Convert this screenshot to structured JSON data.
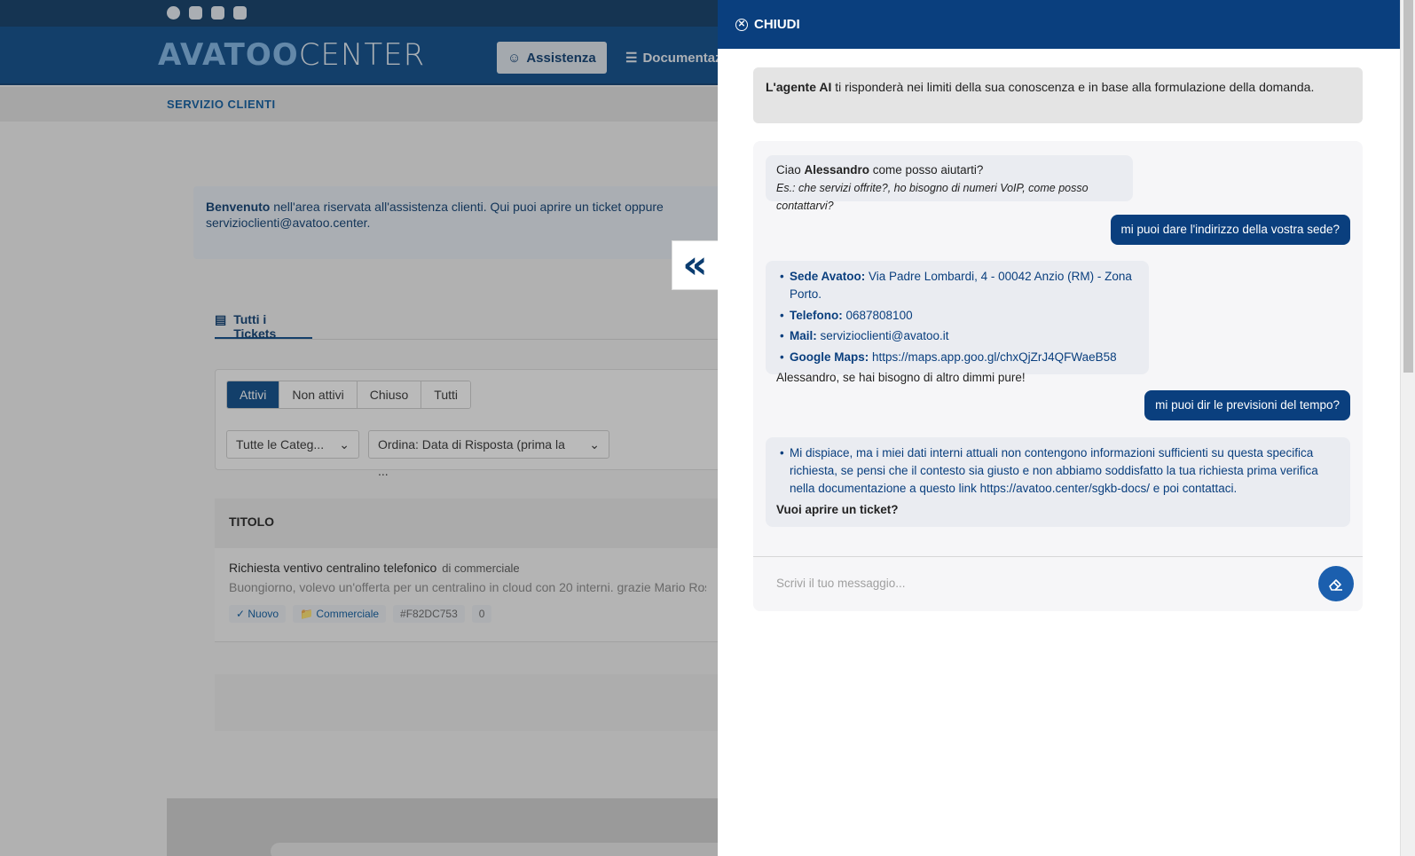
{
  "site": {
    "logo_left": "AVATOO",
    "logo_right": "CENTER",
    "nav": {
      "assistenza": "Assistenza",
      "documentazione": "Documentazi"
    },
    "subnav": "SERVIZIO CLIENTI",
    "welcome": {
      "bold": "Benvenuto",
      "text": " nell'area riservata all'assistenza clienti. Qui puoi aprire un ticket oppure ",
      "email": "servizioclienti@avatoo.center",
      "period": "."
    },
    "tab_all": "Tutti i Tickets",
    "segments": [
      "Attivi",
      "Non attivi",
      "Chiuso",
      "Tutti"
    ],
    "select_category": "Tutte le Categ...",
    "select_order": "Ordina: Data di Risposta (prima la ...",
    "table_header": "TITOLO",
    "ticket": {
      "title": "Richiesta ventivo centralino telefonico",
      "by": "di commerciale",
      "desc": "Buongiorno, volevo un'offerta per un centralino in cloud con 20 interni. grazie Mario Ross",
      "status": "Nuovo",
      "category": "Commerciale",
      "id": "#F82DC753",
      "count": "0"
    }
  },
  "panel": {
    "close_label": "CHIUDI",
    "disclaimer_bold": "L'agente AI",
    "disclaimer_text": " ti risponderà nei limiti della sua conoscenza e in base alla formulazione della domanda.",
    "msg1": {
      "hello": "Ciao ",
      "name": "Alessandro",
      "rest": " come posso aiutarti?",
      "example": "Es.: che servizi offrite?, ho bisogno di numeri VoIP, come posso contattarvi?"
    },
    "user1": "mi puoi dare l'indirizzo della vostra sede?",
    "msg2": {
      "items": [
        {
          "label": "Sede Avatoo:",
          "value": " Via Padre Lombardi, 4 - 00042 Anzio (RM) - Zona Porto."
        },
        {
          "label": "Telefono:",
          "value": " 0687808100"
        },
        {
          "label": "Mail:",
          "value": " servizioclienti@avatoo.it"
        },
        {
          "label": "Google Maps:",
          "value": " https://maps.app.goo.gl/chxQjZrJ4QFWaeB58"
        }
      ],
      "tail": "Alessandro, se hai bisogno di altro dimmi pure!"
    },
    "user2": "mi puoi dir le previsioni del tempo?",
    "msg3": {
      "item": "Mi dispiace, ma i miei dati interni attuali non contengono informazioni sufficienti su questa specifica richiesta, se pensi che il contesto sia giusto e non abbiamo soddisfatto la tua richiesta prima verifica nella documentazione a questo link https://avatoo.center/sgkb-docs/ e poi contattaci.",
      "tail": "Vuoi aprire un ticket?"
    },
    "input_placeholder": "Scrivi il tuo messaggio...",
    "send_icon": "eraser-icon"
  },
  "colors": {
    "primary": "#0a3f7e",
    "accent": "#1b5fae"
  }
}
